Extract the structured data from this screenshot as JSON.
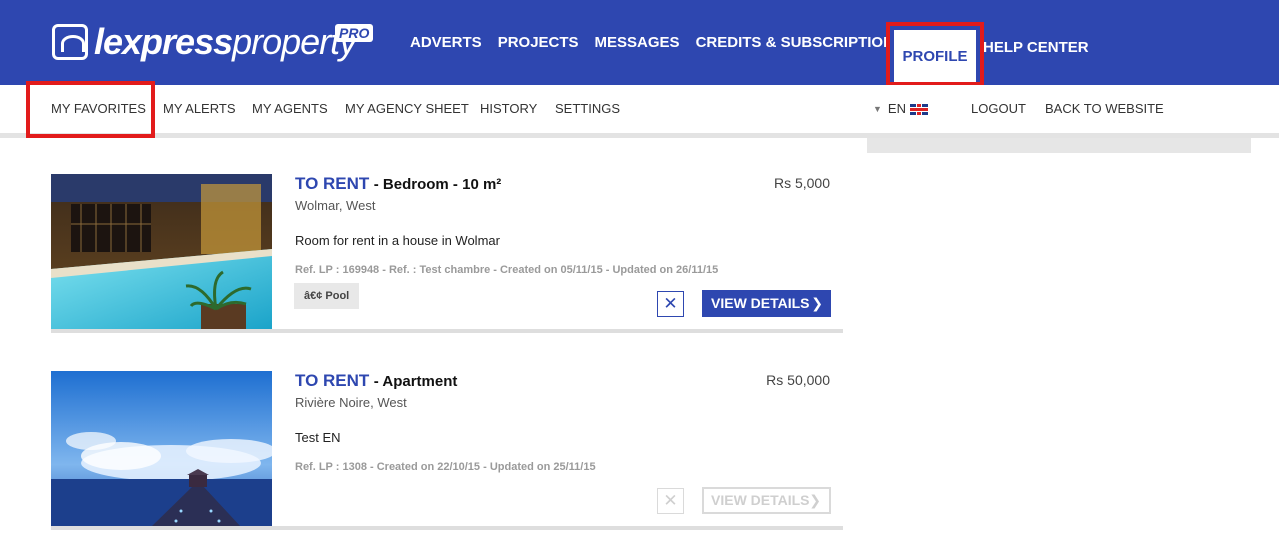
{
  "header": {
    "logo": {
      "word_bold": "lexpress",
      "word_regular": "property",
      "badge": "PRO"
    },
    "nav": [
      "ADVERTS",
      "PROJECTS",
      "MESSAGES",
      "CREDITS & SUBSCRIPTIONS"
    ],
    "profile": "PROFILE",
    "help": "HELP CENTER",
    "colors": {
      "brand": "#2e47b0",
      "highlight": "#e21b1b"
    }
  },
  "subnav": {
    "items": [
      "MY FAVORITES",
      "MY ALERTS",
      "MY AGENTS",
      "MY AGENCY SHEET",
      "HISTORY",
      "SETTINGS"
    ],
    "language": "EN",
    "logout": "LOGOUT",
    "back": "BACK TO WEBSITE"
  },
  "listings": [
    {
      "status": "TO RENT",
      "title": "- Bedroom - 10 m²",
      "location": "Wolmar, West",
      "description": "Room for rent in a house in Wolmar",
      "ref": "Ref. LP : 169948 - Ref. : Test chambre - Created on 05/11/15 - Updated on 26/11/15",
      "price": "Rs 5,000",
      "tag": "â€¢ Pool",
      "remove_icon": "✕",
      "view_label": "VIEW DETAILS",
      "active": true
    },
    {
      "status": "TO RENT",
      "title": "- Apartment",
      "location": "Rivière Noire, West",
      "description": "Test EN",
      "ref": "Ref. LP : 1308 - Created on 22/10/15 - Updated on 25/11/15",
      "price": "Rs 50,000",
      "remove_icon": "✕",
      "view_label": "VIEW DETAILS",
      "active": false
    }
  ]
}
